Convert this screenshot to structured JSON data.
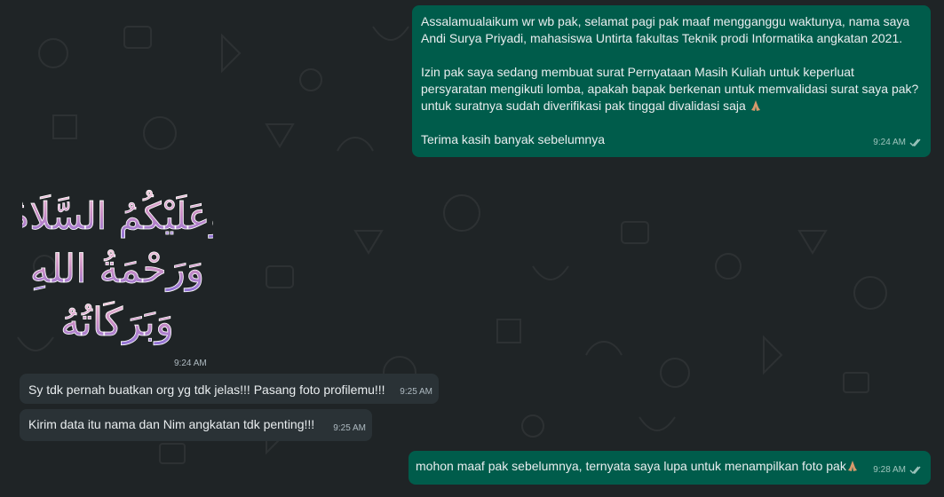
{
  "messages": [
    {
      "direction": "outgoing",
      "paragraphs": [
        "Assalamualaikum wr wb pak, selamat pagi pak maaf mengganggu waktunya, nama saya Andi Surya Priyadi, mahasiswa Untirta fakultas Teknik prodi Informatika angkatan 2021.",
        "Izin pak saya sedang membuat surat Pernyataan Masih Kuliah untuk keperluat persyaratan mengikuti lomba, apakah bapak berkenan untuk memvalidasi surat saya pak? untuk suratnya sudah diverifikasi pak tinggal divalidasi saja",
        "Terima kasih banyak sebelumnya"
      ],
      "time": "9:24 AM",
      "status": "read-double-check-icon"
    },
    {
      "direction": "incoming",
      "type": "sticker",
      "sticker_lines": [
        "وَعَلَيْكُمُ السَّلَامُ",
        "وَرَحْمَةُ اللهِ",
        "وَبَرَكَاتُهُ"
      ],
      "time": "9:24 AM"
    },
    {
      "direction": "incoming",
      "text": "Sy tdk pernah buatkan org yg tdk jelas!!! Pasang foto profilemu!!!",
      "time": "9:25 AM"
    },
    {
      "direction": "incoming",
      "text": "Kirim data itu nama dan Nim angkatan tdk penting!!!",
      "time": "9:25 AM"
    },
    {
      "direction": "outgoing",
      "text": "mohon maaf pak sebelumnya, ternyata saya lupa untuk menampilkan foto pak",
      "time": "9:28 AM",
      "status": "read-double-check-icon"
    }
  ],
  "colors": {
    "background": "#1f2426",
    "outgoing_bubble": "#005c4b",
    "incoming_bubble": "#2a3236",
    "text": "#e9edef"
  },
  "icons": [
    "praying-hands-emoji",
    "double-check-icon"
  ]
}
